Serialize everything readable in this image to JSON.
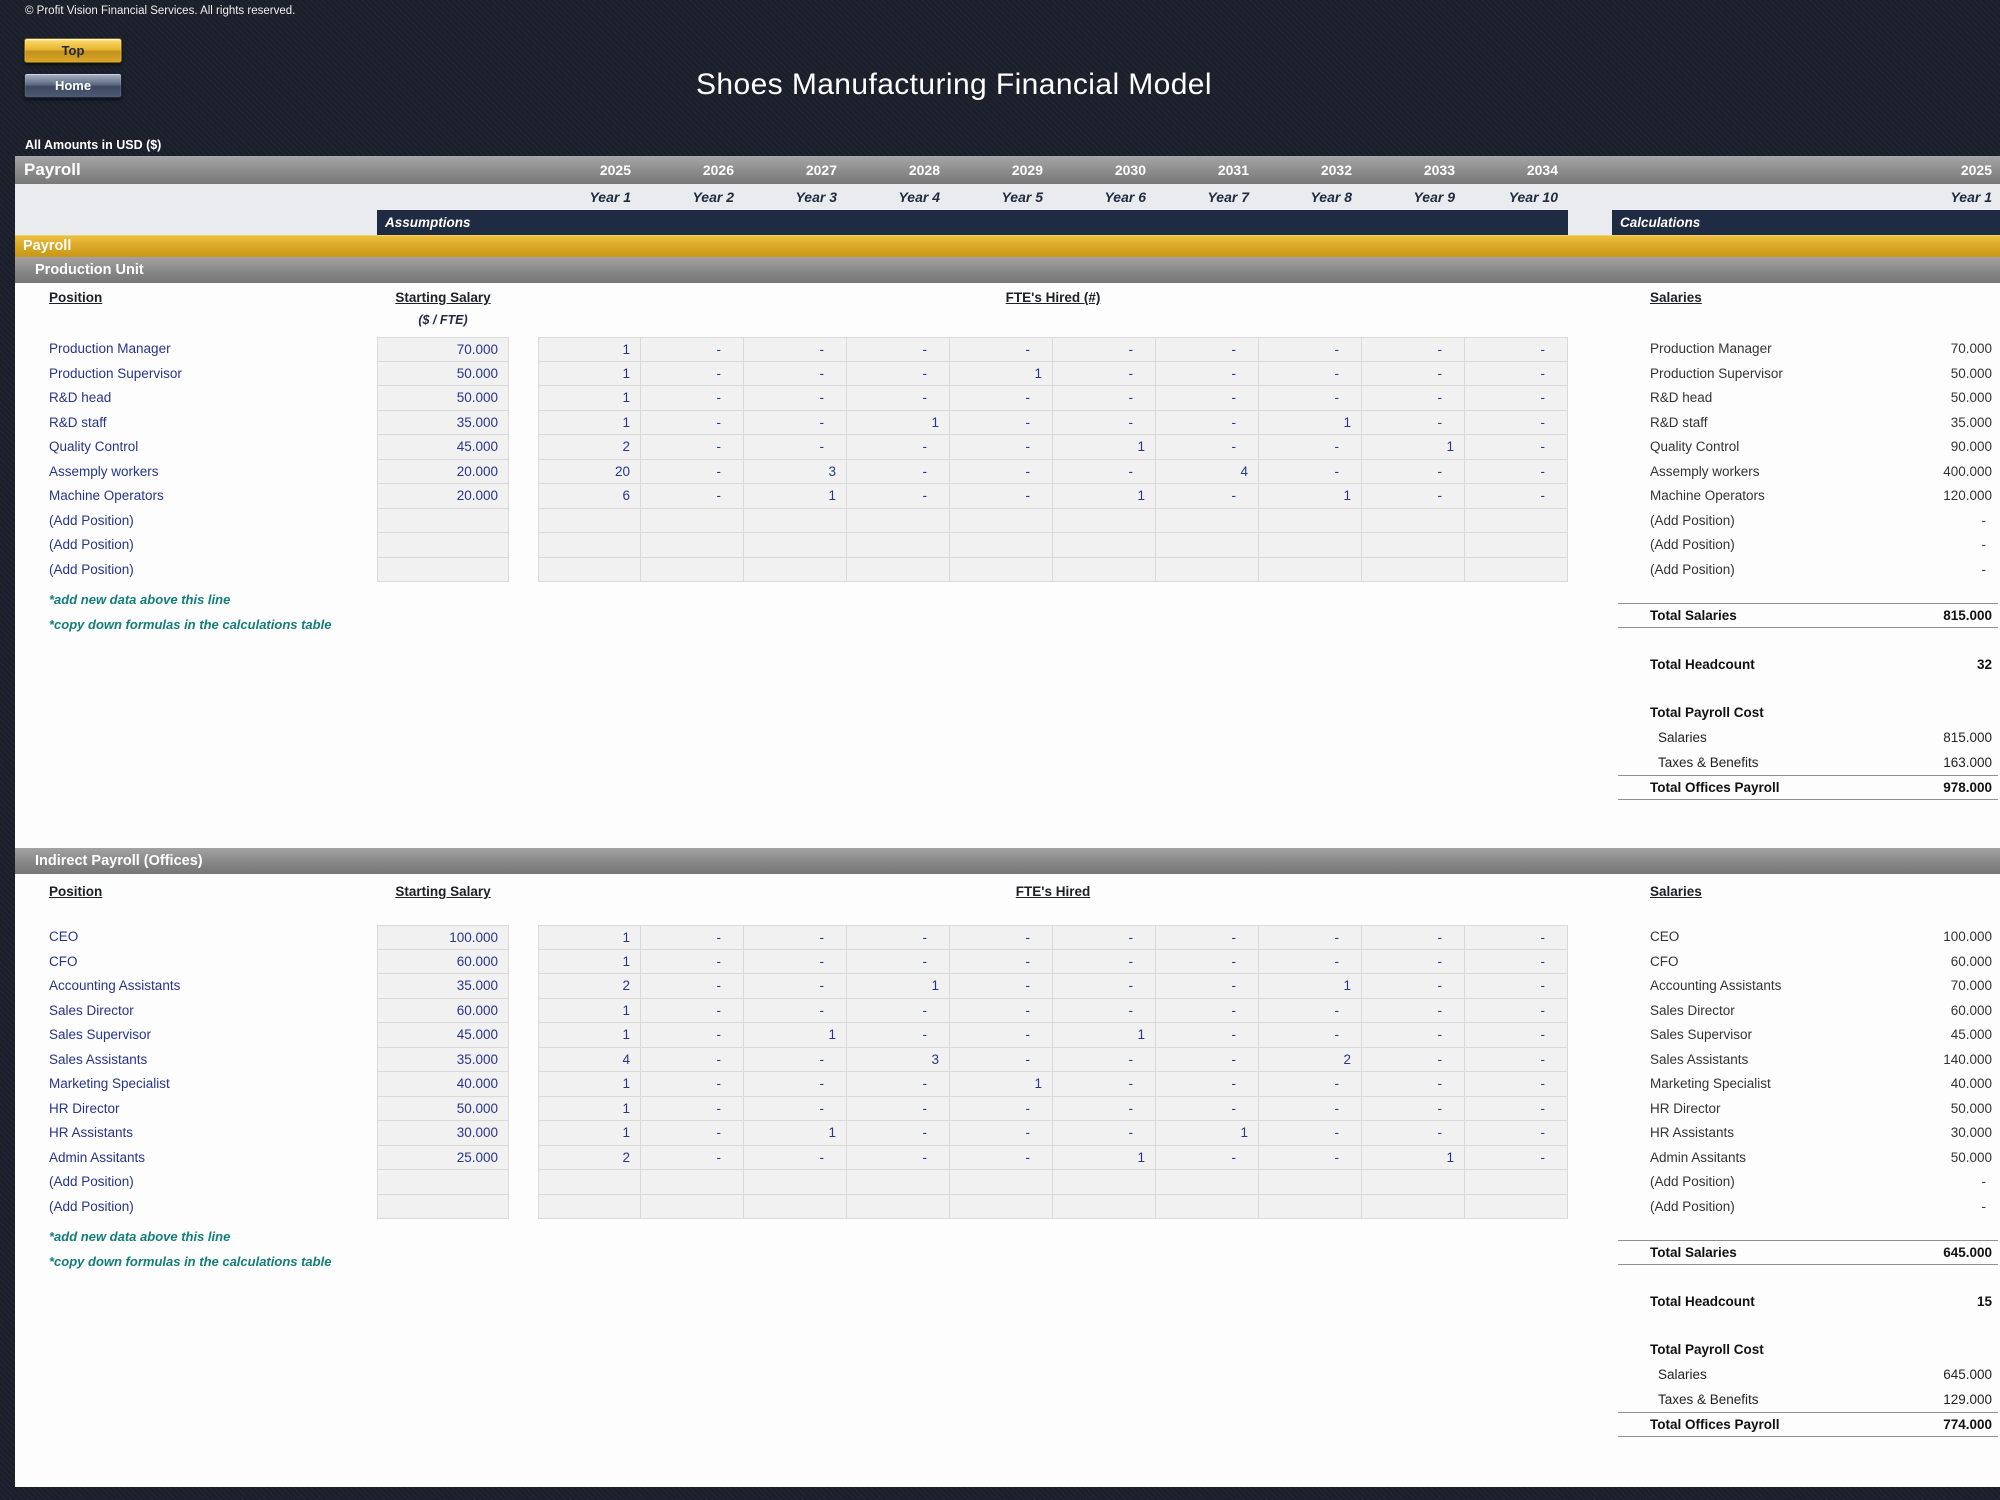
{
  "header": {
    "copyright": "© Profit Vision Financial Services. All rights reserved.",
    "top_button": "Top",
    "home_button": "Home",
    "title": "Shoes Manufacturing Financial Model",
    "amounts_note": "All Amounts in  USD ($)"
  },
  "timeline": {
    "page_band_label": "Payroll",
    "years": [
      "2025",
      "2026",
      "2027",
      "2028",
      "2029",
      "2030",
      "2031",
      "2032",
      "2033",
      "2034"
    ],
    "year_labels": [
      "Year 1",
      "Year 2",
      "Year 3",
      "Year 4",
      "Year 5",
      "Year 6",
      "Year 7",
      "Year 8",
      "Year 9",
      "Year 10"
    ],
    "right_year": "2025",
    "right_year_label": "Year 1",
    "assumptions_label": "Assumptions",
    "calculations_label": "Calculations"
  },
  "group_band_label": "Payroll",
  "notes": {
    "line1": "*add new data above this line",
    "line2": "*copy down formulas in the calculations table"
  },
  "sections": [
    {
      "title": "Production Unit",
      "position_header": "Position",
      "salary_header": "Starting Salary",
      "salary_subheader": "($ / FTE)",
      "fte_header": "FTE's Hired (#)",
      "salaries_header": "Salaries",
      "rows": [
        {
          "position": "Production Manager",
          "salary": "70.000",
          "fte": [
            "1",
            "-",
            "-",
            "-",
            "-",
            "-",
            "-",
            "-",
            "-",
            "-"
          ],
          "calc_salary": "70.000"
        },
        {
          "position": "Production Supervisor",
          "salary": "50.000",
          "fte": [
            "1",
            "-",
            "-",
            "-",
            "1",
            "-",
            "-",
            "-",
            "-",
            "-"
          ],
          "calc_salary": "50.000"
        },
        {
          "position": "R&D head",
          "salary": "50.000",
          "fte": [
            "1",
            "-",
            "-",
            "-",
            "-",
            "-",
            "-",
            "-",
            "-",
            "-"
          ],
          "calc_salary": "50.000"
        },
        {
          "position": "R&D staff",
          "salary": "35.000",
          "fte": [
            "1",
            "-",
            "-",
            "1",
            "-",
            "-",
            "-",
            "1",
            "-",
            "-"
          ],
          "calc_salary": "35.000"
        },
        {
          "position": "Quality Control",
          "salary": "45.000",
          "fte": [
            "2",
            "-",
            "-",
            "-",
            "-",
            "1",
            "-",
            "-",
            "1",
            "-"
          ],
          "calc_salary": "90.000"
        },
        {
          "position": "Assemply workers",
          "salary": "20.000",
          "fte": [
            "20",
            "-",
            "3",
            "-",
            "-",
            "-",
            "4",
            "-",
            "-",
            "-"
          ],
          "calc_salary": "400.000"
        },
        {
          "position": "Machine Operators",
          "salary": "20.000",
          "fte": [
            "6",
            "-",
            "1",
            "-",
            "-",
            "1",
            "-",
            "1",
            "-",
            "-"
          ],
          "calc_salary": "120.000"
        },
        {
          "position": "(Add Position)",
          "salary": "",
          "fte": [
            "",
            "",
            "",
            "",
            "",
            "",
            "",
            "",
            "",
            ""
          ],
          "calc_salary": "-"
        },
        {
          "position": "(Add Position)",
          "salary": "",
          "fte": [
            "",
            "",
            "",
            "",
            "",
            "",
            "",
            "",
            "",
            ""
          ],
          "calc_salary": "-"
        },
        {
          "position": "(Add Position)",
          "salary": "",
          "fte": [
            "",
            "",
            "",
            "",
            "",
            "",
            "",
            "",
            "",
            ""
          ],
          "calc_salary": "-"
        }
      ],
      "totals": {
        "total_salaries_label": "Total Salaries",
        "total_salaries": "815.000",
        "total_headcount_label": "Total Headcount",
        "total_headcount": "32",
        "payroll_cost_label": "Total Payroll Cost",
        "salaries_label": "Salaries",
        "salaries": "815.000",
        "taxes_label": "Taxes & Benefits",
        "taxes": "163.000",
        "total_offices_label": "Total Offices Payroll",
        "total_offices": "978.000"
      }
    },
    {
      "title": "Indirect Payroll (Offices)",
      "position_header": "Position",
      "salary_header": "Starting Salary",
      "salary_subheader": "",
      "fte_header": "FTE's Hired",
      "salaries_header": "Salaries",
      "rows": [
        {
          "position": "CEO",
          "salary": "100.000",
          "fte": [
            "1",
            "-",
            "-",
            "-",
            "-",
            "-",
            "-",
            "-",
            "-",
            "-"
          ],
          "calc_salary": "100.000"
        },
        {
          "position": "CFO",
          "salary": "60.000",
          "fte": [
            "1",
            "-",
            "-",
            "-",
            "-",
            "-",
            "-",
            "-",
            "-",
            "-"
          ],
          "calc_salary": "60.000"
        },
        {
          "position": "Accounting Assistants",
          "salary": "35.000",
          "fte": [
            "2",
            "-",
            "-",
            "1",
            "-",
            "-",
            "-",
            "1",
            "-",
            "-"
          ],
          "calc_salary": "70.000"
        },
        {
          "position": "Sales Director",
          "salary": "60.000",
          "fte": [
            "1",
            "-",
            "-",
            "-",
            "-",
            "-",
            "-",
            "-",
            "-",
            "-"
          ],
          "calc_salary": "60.000"
        },
        {
          "position": "Sales Supervisor",
          "salary": "45.000",
          "fte": [
            "1",
            "-",
            "1",
            "-",
            "-",
            "1",
            "-",
            "-",
            "-",
            "-"
          ],
          "calc_salary": "45.000"
        },
        {
          "position": "Sales Assistants",
          "salary": "35.000",
          "fte": [
            "4",
            "-",
            "-",
            "3",
            "-",
            "-",
            "-",
            "2",
            "-",
            "-"
          ],
          "calc_salary": "140.000"
        },
        {
          "position": "Marketing Specialist",
          "salary": "40.000",
          "fte": [
            "1",
            "-",
            "-",
            "-",
            "1",
            "-",
            "-",
            "-",
            "-",
            "-"
          ],
          "calc_salary": "40.000"
        },
        {
          "position": "HR Director",
          "salary": "50.000",
          "fte": [
            "1",
            "-",
            "-",
            "-",
            "-",
            "-",
            "-",
            "-",
            "-",
            "-"
          ],
          "calc_salary": "50.000"
        },
        {
          "position": "HR Assistants",
          "salary": "30.000",
          "fte": [
            "1",
            "-",
            "1",
            "-",
            "-",
            "-",
            "1",
            "-",
            "-",
            "-"
          ],
          "calc_salary": "30.000"
        },
        {
          "position": "Admin Assitants",
          "salary": "25.000",
          "fte": [
            "2",
            "-",
            "-",
            "-",
            "-",
            "1",
            "-",
            "-",
            "1",
            "-"
          ],
          "calc_salary": "50.000"
        },
        {
          "position": "(Add Position)",
          "salary": "",
          "fte": [
            "",
            "",
            "",
            "",
            "",
            "",
            "",
            "",
            "",
            ""
          ],
          "calc_salary": "-"
        },
        {
          "position": "(Add Position)",
          "salary": "",
          "fte": [
            "",
            "",
            "",
            "",
            "",
            "",
            "",
            "",
            "",
            ""
          ],
          "calc_salary": "-"
        }
      ],
      "totals": {
        "total_salaries_label": "Total Salaries",
        "total_salaries": "645.000",
        "total_headcount_label": "Total Headcount",
        "total_headcount": "15",
        "payroll_cost_label": "Total Payroll Cost",
        "salaries_label": "Salaries",
        "salaries": "645.000",
        "taxes_label": "Taxes & Benefits",
        "taxes": "129.000",
        "total_offices_label": "Total Offices Payroll",
        "total_offices": "774.000"
      }
    }
  ]
}
